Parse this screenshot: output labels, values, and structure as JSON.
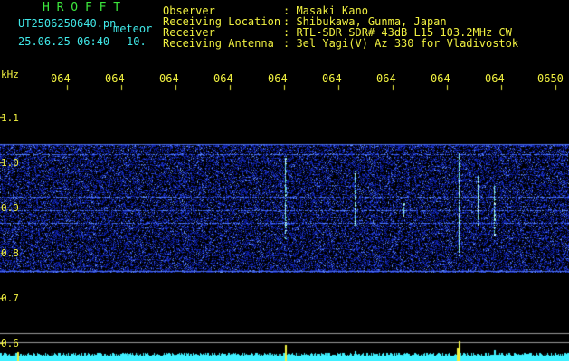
{
  "header": {
    "brand": "H R O F F T",
    "filename": "UT2506250640.pn",
    "mode": "meteor",
    "datetime": "25.06.25 06:40",
    "interval": "10.",
    "fields": [
      {
        "label": "Observer",
        "value": ": Masaki Kano"
      },
      {
        "label": "Receiving Location",
        "value": ": Shibukawa, Gunma, Japan"
      },
      {
        "label": "Receiver",
        "value": ": RTL-SDR SDR# 43dB L15 103.2MHz CW"
      },
      {
        "label": "Receiving Antenna",
        "value": ": 3el Yagi(V) Az 330 for Vladivostok"
      }
    ]
  },
  "axes": {
    "unit": "kHz",
    "time_ticks": [
      "064",
      "064",
      "064",
      "064",
      "064",
      "064",
      "064",
      "064",
      "064",
      "0650"
    ],
    "freq_ticks": [
      "1.1",
      "1.0",
      "0.9",
      "0.8",
      "0.7",
      "0.6"
    ]
  },
  "colors": {
    "background": "#000000",
    "noise_low": "#0a1a9a",
    "noise_high": "#4a7aff",
    "echo": "#b0ffff",
    "label_yellow": "#f0f040",
    "label_green": "#3ce63c",
    "label_cyan": "#40e8e8",
    "power_cyan": "#40f0ff"
  }
}
